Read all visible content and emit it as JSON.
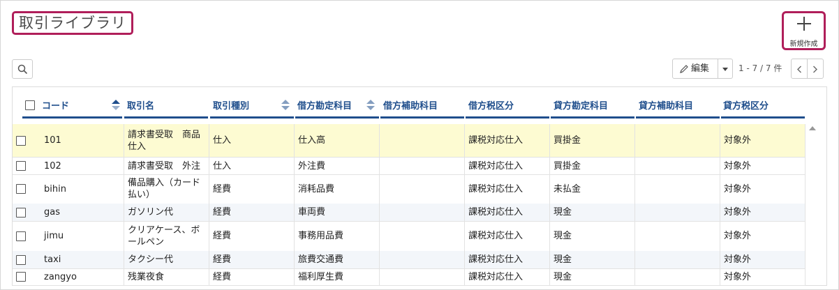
{
  "page": {
    "title": "取引ライブラリ"
  },
  "toolbar": {
    "new_label": "新規作成",
    "edit_label": "編集",
    "page_count": "1 - 7 / 7 件"
  },
  "table": {
    "headers": {
      "code": "コード",
      "name": "取引名",
      "type": "取引種別",
      "debit_account": "借方勘定科目",
      "debit_sub": "借方補助科目",
      "debit_tax": "借方税区分",
      "credit_account": "貸方勘定科目",
      "credit_sub": "貸方補助科目",
      "credit_tax": "貸方税区分"
    },
    "rows": [
      {
        "code": "101",
        "name": "請求書受取　商品仕入",
        "type": "仕入",
        "debit_account": "仕入高",
        "debit_sub": "",
        "debit_tax": "課税対応仕入",
        "credit_account": "買掛金",
        "credit_sub": "",
        "credit_tax": "対象外"
      },
      {
        "code": "102",
        "name": "請求書受取　外注",
        "type": "仕入",
        "debit_account": "外注費",
        "debit_sub": "",
        "debit_tax": "課税対応仕入",
        "credit_account": "買掛金",
        "credit_sub": "",
        "credit_tax": "対象外"
      },
      {
        "code": "bihin",
        "name": "備品購入（カード払い）",
        "type": "経費",
        "debit_account": "消耗品費",
        "debit_sub": "",
        "debit_tax": "課税対応仕入",
        "credit_account": "未払金",
        "credit_sub": "",
        "credit_tax": "対象外"
      },
      {
        "code": "gas",
        "name": "ガソリン代",
        "type": "経費",
        "debit_account": "車両費",
        "debit_sub": "",
        "debit_tax": "課税対応仕入",
        "credit_account": "現金",
        "credit_sub": "",
        "credit_tax": "対象外"
      },
      {
        "code": "jimu",
        "name": "クリアケース、ボールペン",
        "type": "経費",
        "debit_account": "事務用品費",
        "debit_sub": "",
        "debit_tax": "課税対応仕入",
        "credit_account": "現金",
        "credit_sub": "",
        "credit_tax": "対象外"
      },
      {
        "code": "taxi",
        "name": "タクシー代",
        "type": "経費",
        "debit_account": "旅費交通費",
        "debit_sub": "",
        "debit_tax": "課税対応仕入",
        "credit_account": "現金",
        "credit_sub": "",
        "credit_tax": "対象外"
      },
      {
        "code": "zangyo",
        "name": "残業夜食",
        "type": "経費",
        "debit_account": "福利厚生費",
        "debit_sub": "",
        "debit_tax": "課税対応仕入",
        "credit_account": "現金",
        "credit_sub": "",
        "credit_tax": "対象外"
      }
    ]
  }
}
